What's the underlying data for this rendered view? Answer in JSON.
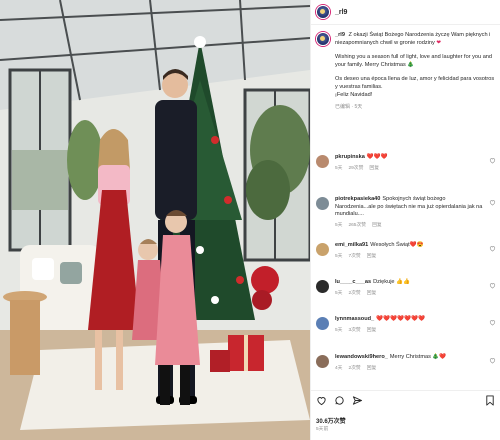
{
  "post": {
    "username": "_rl9",
    "likes": "30.6万次赞",
    "date": "5天前"
  },
  "caption": {
    "username": "_rl9",
    "polish": "Z okazji Świąt Bożego Narodzenia życzę Wam pięknych i niezapomnianych chwil w gronie rodziny",
    "english": "Wishing you a season full of light, love and laughter for you and your family. Merry Christmas 🎄",
    "spanish": "Os deseo una época llena de luz, amor y felicidad para vosotros y vuestras familias.",
    "spanish_end": "¡Feliz Navidad!",
    "time": "已编辑",
    "translate": "5天 · 查看翻译",
    "edited": "已编辑 · 5天"
  },
  "comments": [
    {
      "user": "pkrupinska",
      "text": "❤️❤️❤️",
      "time": "5天",
      "likes": "29次赞",
      "reply": "回复",
      "avatar_color": "#b98a6e"
    },
    {
      "user": "piotrekpasieka40",
      "text": "Spokojnych świąt bożego Narodzenia...ale po świętach nie ma już opierdalania jak na mundialu....",
      "time": "5天",
      "likes": "265次赞",
      "reply": "回复",
      "avatar_color": "#7d8c96"
    },
    {
      "user": "emi_milka91",
      "text": "Wesołych Świąt❤️😍",
      "time": "5天",
      "likes": "7次赞",
      "reply": "回复",
      "avatar_color": "#c9a26b"
    },
    {
      "user": "lu____c___as",
      "text": "Dziękuje 👍👍",
      "time": "5天",
      "likes": "2次赞",
      "reply": "回复",
      "avatar_color": "#2b2b2b"
    },
    {
      "user": "lynnmassoud_",
      "text": "❤️❤️❤️❤️❤️❤️❤️",
      "time": "5天",
      "likes": "3次赞",
      "reply": "回复",
      "avatar_color": "#5b7fb5"
    },
    {
      "user": "lewandowski9hero_",
      "text": "Merry Christmas 🎄❤️",
      "time": "4天",
      "likes": "2次赞",
      "reply": "回复",
      "avatar_color": "#8a6d5a"
    }
  ],
  "photo": {
    "alt": "Family in red and black standing in front of a Christmas tree in a sunroom"
  }
}
